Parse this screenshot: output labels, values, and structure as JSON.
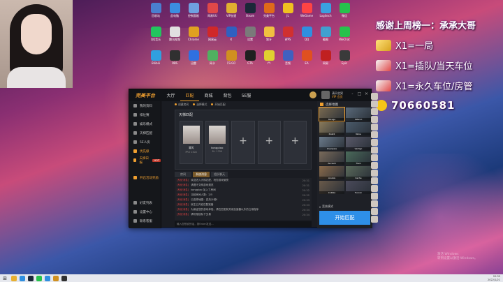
{
  "overlay": {
    "title": "感谢上周榜一：承承大哥",
    "rows": [
      {
        "icon": "gold-bar-icon",
        "text": "X1=一局"
      },
      {
        "icon": "rocket-icon",
        "text": "X1=插队/当天车位"
      },
      {
        "icon": "rocket-icon",
        "text": "X1=永久车位/房管"
      },
      {
        "icon": "qq-icon",
        "text": "70660581"
      }
    ]
  },
  "desktop_icons": [
    {
      "label": "回收站",
      "color": "#4a7fd0"
    },
    {
      "label": "此电脑",
      "color": "#3b8de0"
    },
    {
      "label": "控制面板",
      "color": "#6fa0e0"
    },
    {
      "label": "网易UU",
      "color": "#e04848"
    },
    {
      "label": "VIP加速",
      "color": "#e0b030"
    },
    {
      "label": "Steam",
      "color": "#1b2838"
    },
    {
      "label": "完美平台",
      "color": "#e06a1a"
    },
    {
      "label": "JL",
      "color": "#f0c020"
    },
    {
      "label": "WeGame",
      "color": "#ff4444"
    },
    {
      "label": "Logitech",
      "color": "#3aa0e0"
    },
    {
      "label": "微信",
      "color": "#27c24c"
    },
    {
      "label": "QQ音乐",
      "color": "#22c55e"
    },
    {
      "label": "腾讯视频",
      "color": "#e0e0e0"
    },
    {
      "label": "Chrome",
      "color": "#e0a020"
    },
    {
      "label": "网易云",
      "color": "#d02828"
    },
    {
      "label": "K",
      "color": "#3060c0"
    },
    {
      "label": "设置",
      "color": "#7a7a7a"
    },
    {
      "label": "狼牙",
      "color": "#f0c040"
    },
    {
      "label": "WPS",
      "color": "#d03030"
    },
    {
      "label": "QQ",
      "color": "#2f8fe0"
    },
    {
      "label": "截图",
      "color": "#40a0d0"
    },
    {
      "label": "WeChat",
      "color": "#27c24c"
    },
    {
      "label": "Bilibili",
      "color": "#30a0e0"
    },
    {
      "label": "OBS",
      "color": "#303030"
    },
    {
      "label": "迅雷",
      "color": "#3070e0"
    },
    {
      "label": "网卡",
      "color": "#50b060"
    },
    {
      "label": "CS:GO",
      "color": "#d09020"
    },
    {
      "label": "GTA",
      "color": "#202020"
    },
    {
      "label": "YY",
      "color": "#e0d030"
    },
    {
      "label": "音频",
      "color": "#4060c0"
    },
    {
      "label": "EA",
      "color": "#e05020"
    },
    {
      "label": "网易",
      "color": "#c02020"
    },
    {
      "label": "Epic",
      "color": "#3a3a3a"
    }
  ],
  "app": {
    "logo": "完美平台",
    "nav": [
      "大厅",
      "匹配",
      "商城",
      "背包",
      "5E服"
    ],
    "nav_active_index": 1,
    "user": {
      "name": "清风北冥",
      "sub": "VIP 会员"
    },
    "window_controls": [
      "-",
      "□",
      "×"
    ],
    "sidebar": [
      {
        "label": "我的资料",
        "highlight": false
      },
      {
        "label": "排位赛",
        "highlight": false
      },
      {
        "label": "娱乐模式",
        "highlight": false
      },
      {
        "label": "天梯匹配",
        "highlight": false
      },
      {
        "label": "5E人房",
        "highlight": false
      },
      {
        "label": "优先级",
        "highlight": true
      },
      {
        "label": "天梯日报",
        "highlight": true,
        "badge": "HOT"
      }
    ],
    "sidebar_extra": {
      "label": "开启活动奖励",
      "highlight": true
    },
    "sidebar_bottom": [
      "好友列表",
      "设置中心",
      "联系客服"
    ],
    "steps": [
      "创建房间",
      "选择模式",
      "开始匹配"
    ],
    "room": {
      "title": "天梯匹配",
      "players": [
        {
          "name": "清风",
          "sub": "PRO 1500"
        },
        {
          "name": "kongpiao",
          "sub": "B+ 1350"
        }
      ],
      "empty_slots": 3
    },
    "chat_tabs": [
      "房间",
      "系统消息",
      "组队聊天"
    ],
    "chat_active_index": 1,
    "chat": [
      {
        "who": "[系统消息]",
        "text": "欢迎进入天梯匹配，祝您游戏愉快",
        "time": "20:31"
      },
      {
        "who": "[系统消息]",
        "text": "请遵守文明游戏规范",
        "time": "20:31"
      },
      {
        "who": "[系统消息]",
        "text": "kongpiao 加入了房间",
        "time": "20:32"
      },
      {
        "who": "[系统消息]",
        "text": "当前房间人数：2/5",
        "time": "20:32"
      },
      {
        "who": "[系统消息]",
        "text": "已选择地图：炙热沙城II",
        "time": "20:33"
      },
      {
        "who": "[系统消息]",
        "text": "房主已开启匹配准备",
        "time": "20:33"
      },
      {
        "who": "[系统消息]",
        "text": "为保证您的游戏体验，请在匹配前关闭加速器以外的占用程序",
        "time": "20:34"
      },
      {
        "who": "[系统消息]",
        "text": "请勿相信私下交易",
        "time": "20:34"
      }
    ],
    "chat_placeholder": "输入您想说的话，按Enter发送...",
    "maps_title": "选择地图",
    "maps": [
      {
        "name": "Mirage",
        "selected": true
      },
      {
        "name": "Inferno",
        "selected": false
      },
      {
        "name": "Dust2",
        "selected": false
      },
      {
        "name": "Nuke",
        "selected": false
      },
      {
        "name": "Overpass",
        "selected": false
      },
      {
        "name": "Vertigo",
        "selected": false
      },
      {
        "name": "Ancient",
        "selected": false
      },
      {
        "name": "Train",
        "selected": false
      },
      {
        "name": "Anubis",
        "selected": false
      },
      {
        "name": "Cache",
        "selected": false
      },
      {
        "name": "Cobble",
        "selected": false
      },
      {
        "name": "Tuscan",
        "selected": false
      }
    ],
    "mode_label": "竞技模式",
    "start_button": "开始匹配"
  },
  "watermark": [
    "激活 Windows",
    "转到设置以激活 Windows。"
  ],
  "taskbar": {
    "icons": [
      {
        "name": "file-explorer-icon",
        "color": "#e8b030"
      },
      {
        "name": "edge-icon",
        "color": "#2f8fe0"
      },
      {
        "name": "steam-icon",
        "color": "#1b2838"
      },
      {
        "name": "wechat-icon",
        "color": "#27c24c"
      },
      {
        "name": "qq-icon",
        "color": "#2f8fe0"
      },
      {
        "name": "game-icon",
        "color": "#d09020"
      },
      {
        "name": "obs-icon",
        "color": "#303030"
      }
    ],
    "time": "20:35",
    "date": "2022/1/21"
  }
}
